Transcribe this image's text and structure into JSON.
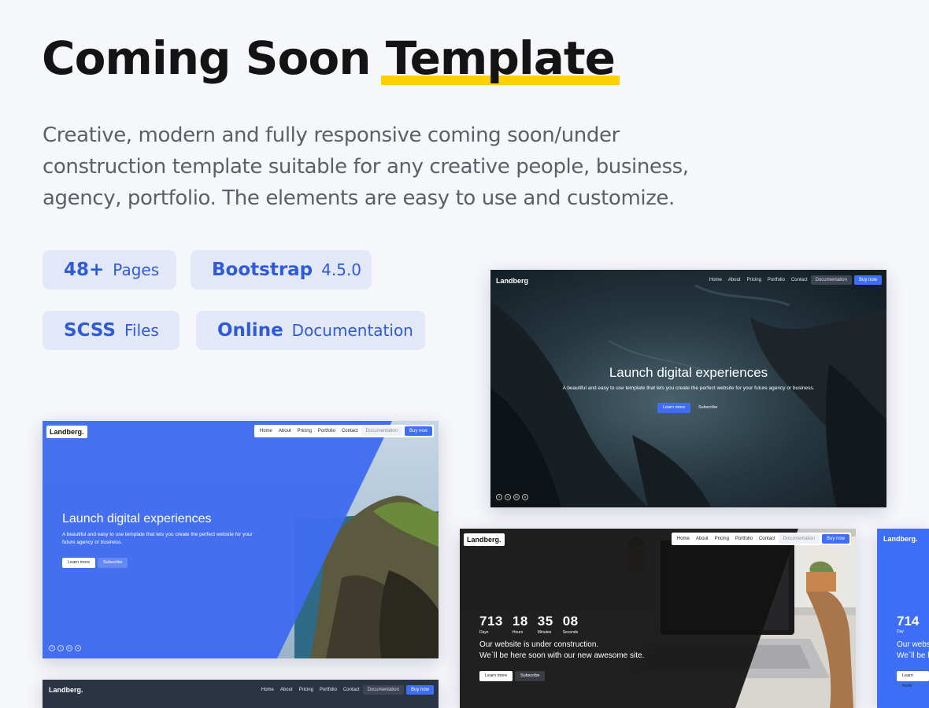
{
  "header": {
    "title_part1": "Coming Soon",
    "title_highlight": "Template",
    "highlight_color": "#ffd000",
    "description": "Creative, modern and fully responsive coming soon/under construction template suitable for any creative people, business, agency, portfolio. The elements are easy to use and customize."
  },
  "features": [
    {
      "bold": "48+",
      "normal": "Pages"
    },
    {
      "bold": "Bootstrap",
      "normal": "4.5.0"
    },
    {
      "bold": "SCSS",
      "normal": "Files"
    },
    {
      "bold": "Online",
      "normal": "Documentation"
    }
  ],
  "accent_color": "#3d6ef5",
  "cards": {
    "nav_items": [
      "Home",
      "About",
      "Pricing",
      "Portfolio",
      "Contact"
    ],
    "documentation": "Documentation",
    "buy": "Buy now",
    "ocean": {
      "brand": "Landberg",
      "headline": "Launch digital experiences",
      "sub": "A beautiful and easy to use template that lets you create the perfect website for your future agency or business.",
      "learn": "Learn more",
      "subscribe": "Subscribe"
    },
    "blue": {
      "brand": "Landberg.",
      "headline": "Launch digital experiences",
      "sub": "A beautiful and easy to use template that lets you create the perfect website for your future agency or business.",
      "learn": "Learn more",
      "subscribe": "Subscribe"
    },
    "desk": {
      "brand": "Landberg.",
      "countdown": [
        {
          "value": "713",
          "label": "Days"
        },
        {
          "value": "18",
          "label": "Hours"
        },
        {
          "value": "35",
          "label": "Minutes"
        },
        {
          "value": "08",
          "label": "Seconds"
        }
      ],
      "line1": "Our website is under construction.",
      "line2": "We`ll be here soon with our new awesome site.",
      "learn": "Learn more",
      "subscribe": "Subscribe"
    },
    "bottom": {
      "brand": "Landberg."
    },
    "partial": {
      "brand": "Landberg.",
      "count": "714",
      "label": "Day",
      "line1": "Our webs",
      "line2": "We`ll be h",
      "learn": "Learn more"
    }
  }
}
